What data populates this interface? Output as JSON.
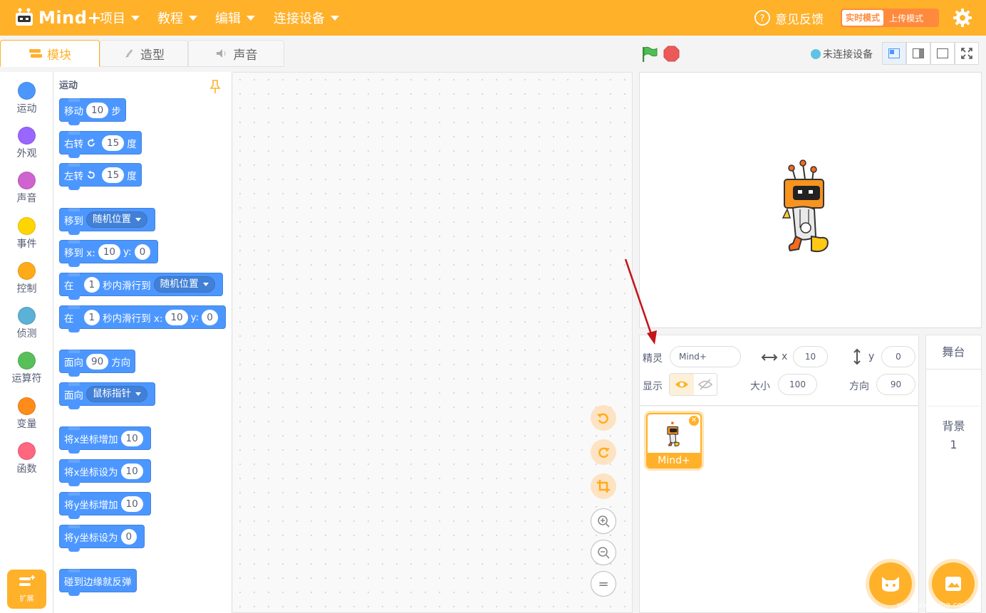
{
  "app": {
    "brand": "Mind+"
  },
  "menu": [
    {
      "label": "项目"
    },
    {
      "label": "教程"
    },
    {
      "label": "编辑"
    },
    {
      "label": "连接设备"
    }
  ],
  "header": {
    "feedback": "意见反馈",
    "mode_realtime": "实时模式",
    "mode_upload": "上传模式"
  },
  "tabs": [
    {
      "label": "模块"
    },
    {
      "label": "造型"
    },
    {
      "label": "声音"
    }
  ],
  "connection": {
    "status": "未连接设备"
  },
  "categories": [
    {
      "label": "运动",
      "color": "#4c97ff"
    },
    {
      "label": "外观",
      "color": "#9966ff"
    },
    {
      "label": "声音",
      "color": "#cf63cf"
    },
    {
      "label": "事件",
      "color": "#ffd500"
    },
    {
      "label": "控制",
      "color": "#ffab19"
    },
    {
      "label": "侦测",
      "color": "#5cb1d6"
    },
    {
      "label": "运算符",
      "color": "#59c059"
    },
    {
      "label": "变量",
      "color": "#ff8c1a"
    },
    {
      "label": "函数",
      "color": "#ff6680"
    }
  ],
  "extension": {
    "label": "扩展"
  },
  "palette": {
    "title": "运动",
    "blocks": {
      "move": {
        "a": "移动",
        "v": "10",
        "b": "步"
      },
      "turn_right": {
        "a": "右转",
        "v": "15",
        "b": "度"
      },
      "turn_left": {
        "a": "左转",
        "v": "15",
        "b": "度"
      },
      "goto": {
        "a": "移到",
        "menu": "随机位置"
      },
      "goto_xy": {
        "a": "移到 x:",
        "x": "10",
        "yl": "y:",
        "y": "0"
      },
      "glide": {
        "a": "在",
        "v": "1",
        "b": "秒内滑行到",
        "menu": "随机位置"
      },
      "glide_xy": {
        "a": "在",
        "v": "1",
        "b": "秒内滑行到 x:",
        "x": "10",
        "yl": "y:",
        "y": "0"
      },
      "point_dir": {
        "a": "面向",
        "v": "90",
        "b": "方向"
      },
      "point_towards": {
        "a": "面向",
        "menu": "鼠标指针"
      },
      "change_x": {
        "a": "将x坐标增加",
        "v": "10"
      },
      "set_x": {
        "a": "将x坐标设为",
        "v": "10"
      },
      "change_y": {
        "a": "将y坐标增加",
        "v": "10"
      },
      "set_y": {
        "a": "将y坐标设为",
        "v": "0"
      },
      "bounce": {
        "a": "碰到边缘就反弹"
      }
    }
  },
  "sprite_info": {
    "sprite_label": "精灵",
    "sprite_name": "Mind+",
    "x_label": "x",
    "x": "10",
    "y_label": "y",
    "y": "0",
    "show_label": "显示",
    "size_label": "大小",
    "size": "100",
    "dir_label": "方向",
    "dir": "90"
  },
  "sprites": [
    {
      "name": "Mind+"
    }
  ],
  "stage_panel": {
    "title": "舞台",
    "backdrop_label": "背景",
    "backdrop_count": "1"
  },
  "zoom": {
    "reset_label": "="
  },
  "watermark": "www.xiazaiba.com"
}
